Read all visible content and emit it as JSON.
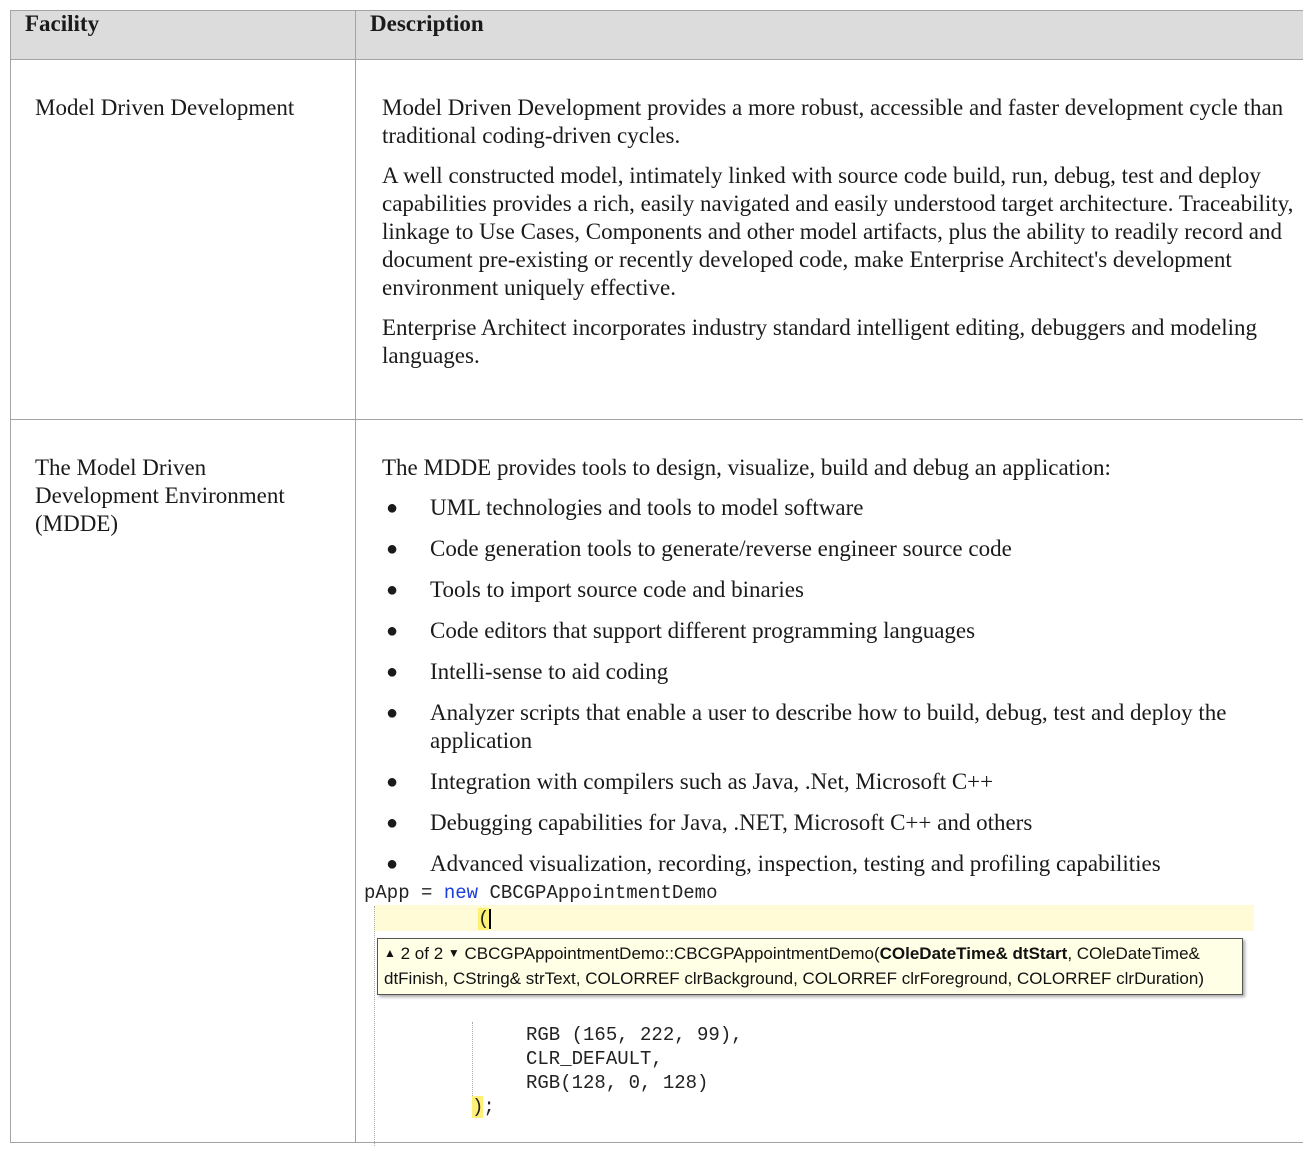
{
  "table": {
    "headers": [
      "Facility",
      "Description"
    ],
    "rows": [
      {
        "facility": "Model Driven Development",
        "paragraphs": [
          "Model Driven Development provides a more robust, accessible and faster development cycle than traditional coding-driven cycles.",
          "A well constructed model, intimately linked with source code build, run, debug, test and deploy capabilities provides a rich, easily navigated and easily understood target architecture. Traceability, linkage to Use Cases, Components and other model artifacts, plus the ability to readily record and document pre-existing or recently developed code, make Enterprise Architect's development environment uniquely effective.",
          "Enterprise Architect incorporates industry standard intelligent editing, debuggers and modeling languages."
        ]
      },
      {
        "facility": "The Model Driven Development Environment (MDDE)",
        "intro": "The MDDE provides tools to design, visualize, build and debug an application:",
        "bullets": [
          "UML technologies and tools to model software",
          "Code generation tools to generate/reverse engineer source code",
          "Tools to import source code and binaries",
          "Code editors that support different programming languages",
          "Intelli-sense to aid coding",
          "Analyzer scripts that enable a user to describe how to build, debug, test and deploy the application",
          "Integration with compilers such as Java, .Net, Microsoft C++",
          "Debugging capabilities for Java, .NET, Microsoft C++ and others",
          "Advanced visualization, recording, inspection, testing and profiling capabilities"
        ]
      }
    ]
  },
  "code": {
    "line1_var": "pApp = ",
    "line1_kw": "new",
    "line1_rest": " CBCGPAppointmentDemo",
    "line2": "(",
    "tooltip_counter": "2 of 2",
    "tooltip_sig_start": "CBCGPAppointmentDemo::CBCGPAppointmentDemo(",
    "tooltip_bold_param": "COleDateTime& dtStart",
    "tooltip_rest": ", COleDateTime& dtFinish, CString& strText, COLORREF clrBackground, COLORREF clrForeground, COLORREF clrDuration)",
    "line3": "RGB (165, 222, 99),",
    "line4": "CLR_DEFAULT,",
    "line5": "RGB(128, 0, 128)",
    "line6_bracket": ")",
    "line6_rest": ";"
  }
}
